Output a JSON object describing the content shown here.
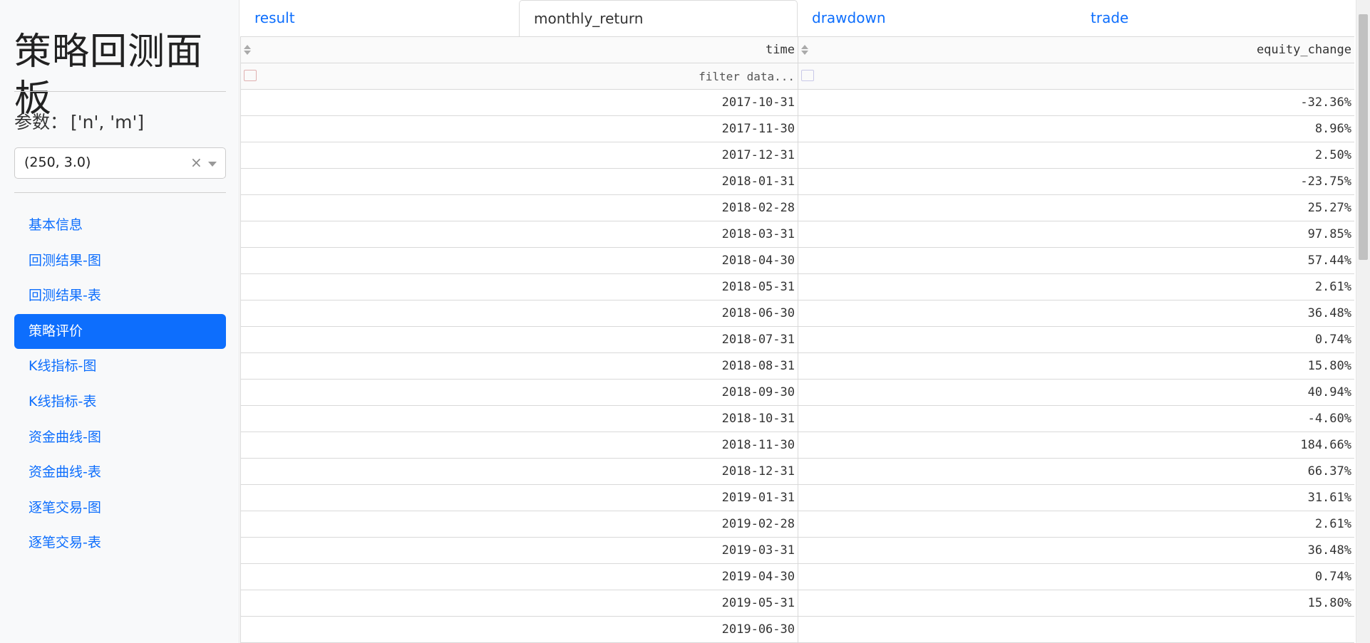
{
  "sidebar": {
    "title": "策略回测面板",
    "params_label": "参数：",
    "params_value": "['n', 'm']",
    "select": {
      "value": "(250, 3.0)",
      "clear": "×"
    },
    "nav": [
      {
        "label": "基本信息",
        "active": false
      },
      {
        "label": "回测结果-图",
        "active": false
      },
      {
        "label": "回测结果-表",
        "active": false
      },
      {
        "label": "策略评价",
        "active": true
      },
      {
        "label": "K线指标-图",
        "active": false
      },
      {
        "label": "K线指标-表",
        "active": false
      },
      {
        "label": "资金曲线-图",
        "active": false
      },
      {
        "label": "资金曲线-表",
        "active": false
      },
      {
        "label": "逐笔交易-图",
        "active": false
      },
      {
        "label": "逐笔交易-表",
        "active": false
      }
    ]
  },
  "tabs": [
    {
      "label": "result",
      "active": false
    },
    {
      "label": "monthly_return",
      "active": true
    },
    {
      "label": "drawdown",
      "active": false
    },
    {
      "label": "trade",
      "active": false
    }
  ],
  "table": {
    "columns": [
      "time",
      "equity_change"
    ],
    "filter_placeholder": "filter data...",
    "rows": [
      [
        "2017-10-31",
        "-32.36%"
      ],
      [
        "2017-11-30",
        "8.96%"
      ],
      [
        "2017-12-31",
        "2.50%"
      ],
      [
        "2018-01-31",
        "-23.75%"
      ],
      [
        "2018-02-28",
        "25.27%"
      ],
      [
        "2018-03-31",
        "97.85%"
      ],
      [
        "2018-04-30",
        "57.44%"
      ],
      [
        "2018-05-31",
        "2.61%"
      ],
      [
        "2018-06-30",
        "36.48%"
      ],
      [
        "2018-07-31",
        "0.74%"
      ],
      [
        "2018-08-31",
        "15.80%"
      ],
      [
        "2018-09-30",
        "40.94%"
      ],
      [
        "2018-10-31",
        "-4.60%"
      ],
      [
        "2018-11-30",
        "184.66%"
      ],
      [
        "2018-12-31",
        "66.37%"
      ],
      [
        "2019-01-31",
        "31.61%"
      ],
      [
        "2019-02-28",
        "2.61%"
      ],
      [
        "2019-03-31",
        "36.48%"
      ],
      [
        "2019-04-30",
        "0.74%"
      ],
      [
        "2019-05-31",
        "15.80%"
      ],
      [
        "2019-06-30",
        ""
      ]
    ]
  },
  "colors": {
    "accent": "#0d6efd",
    "sidebar_bg": "#f8f9fa"
  }
}
